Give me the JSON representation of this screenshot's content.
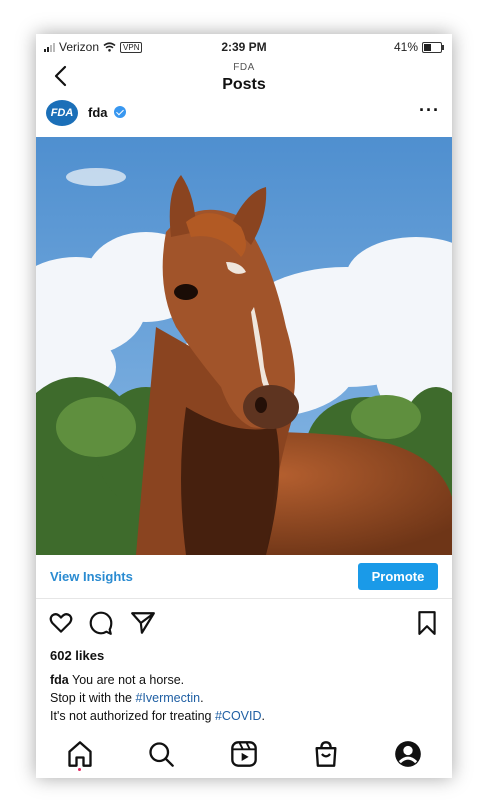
{
  "status": {
    "carrier": "Verizon",
    "vpn_label": "VPN",
    "time": "2:39 PM",
    "battery_text": "41%",
    "battery_level": 0.41
  },
  "header": {
    "subtitle": "FDA",
    "title": "Posts"
  },
  "post": {
    "avatar_text": "FDA",
    "username": "fda",
    "likes": "602 likes",
    "caption": {
      "user": "fda",
      "line1": "You are not a horse.",
      "line2_prefix": "Stop it with the ",
      "line2_tag": "#Ivermectin",
      "line2_suffix": ".",
      "line3_prefix": "It's not authorized for treating ",
      "line3_tag": "#COVID",
      "line3_suffix": "."
    }
  },
  "insights": {
    "view_label": "View Insights",
    "promote_label": "Promote"
  },
  "icons": {
    "back": "chevron-left-icon",
    "more": "more-horizontal-icon",
    "like": "heart-icon",
    "comment": "comment-icon",
    "share": "send-icon",
    "save": "bookmark-icon",
    "home": "home-icon",
    "search": "search-icon",
    "reels": "reels-icon",
    "shop": "shop-icon",
    "profile": "profile-icon"
  },
  "colors": {
    "accent": "#1a9ae8",
    "link": "#2a8bd1",
    "hashtag": "#1f5fa3",
    "verified": "#3897f0"
  }
}
